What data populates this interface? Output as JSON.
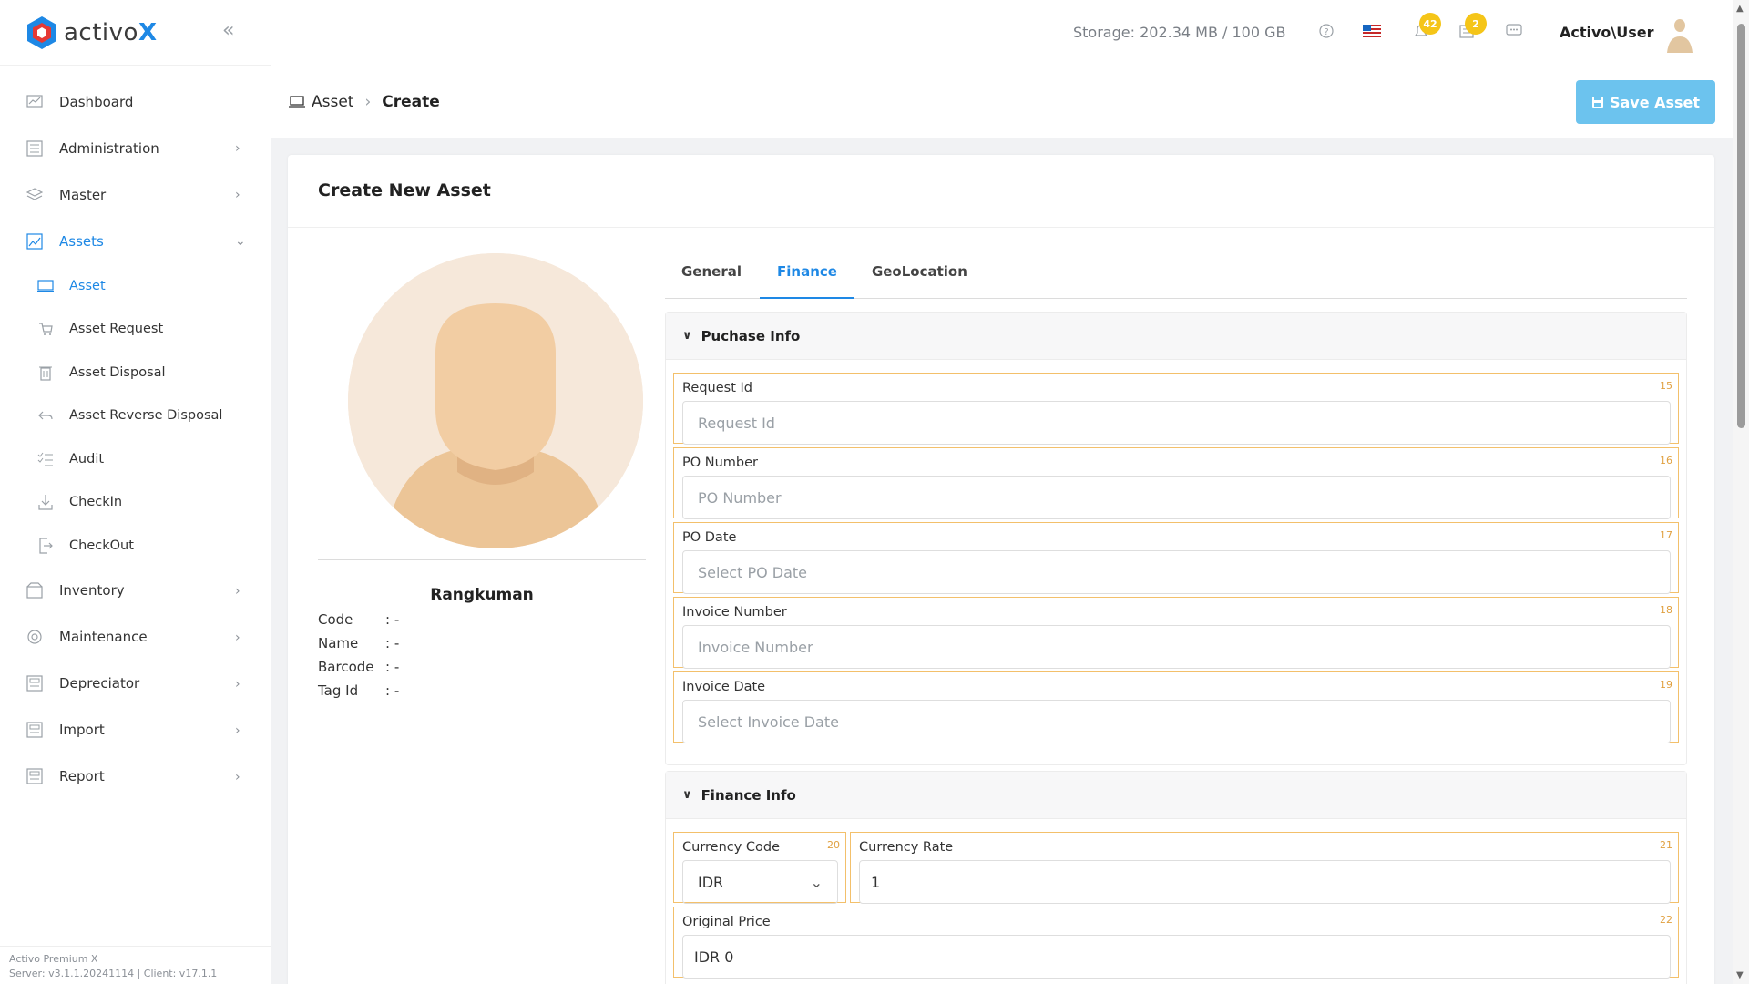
{
  "brand": {
    "name_prefix": "activo",
    "name_suffix": "X",
    "collapse_icon": "double-chevron-left"
  },
  "sidebar": {
    "items": [
      {
        "label": "Dashboard",
        "icon": "dashboard-icon",
        "has_children": false
      },
      {
        "label": "Administration",
        "icon": "administration-icon",
        "has_children": true
      },
      {
        "label": "Master",
        "icon": "master-icon",
        "has_children": true
      },
      {
        "label": "Assets",
        "icon": "assets-icon",
        "has_children": true,
        "expanded": true,
        "active": true
      }
    ],
    "sub_items": [
      {
        "label": "Asset",
        "icon": "asset-icon",
        "active": true
      },
      {
        "label": "Asset Request",
        "icon": "cart-icon"
      },
      {
        "label": "Asset Disposal",
        "icon": "trash-icon"
      },
      {
        "label": "Asset Reverse Disposal",
        "icon": "undo-icon"
      },
      {
        "label": "Audit",
        "icon": "checklist-icon"
      },
      {
        "label": "CheckIn",
        "icon": "download-icon"
      },
      {
        "label": "CheckOut",
        "icon": "logout-icon"
      }
    ],
    "items_after": [
      {
        "label": "Inventory",
        "icon": "inventory-icon"
      },
      {
        "label": "Maintenance",
        "icon": "maintenance-icon"
      },
      {
        "label": "Depreciator",
        "icon": "depreciator-icon"
      },
      {
        "label": "Import",
        "icon": "import-icon"
      },
      {
        "label": "Report",
        "icon": "report-icon"
      }
    ],
    "footer": {
      "product": "Activo Premium X",
      "version": "Server: v3.1.1.20241114 | Client: v17.1.1"
    }
  },
  "topbar": {
    "storage": "Storage: 202.34 MB / 100 GB",
    "notifications_count": "42",
    "tasks_count": "2",
    "user_name": "Activo\\User"
  },
  "breadcrumb": {
    "root": "Asset",
    "current": "Create"
  },
  "actions": {
    "save_label": "Save Asset",
    "accent": "#6cc3ee"
  },
  "card": {
    "title": "Create New Asset"
  },
  "asset_summary": {
    "name": "Rangkuman",
    "rows": [
      {
        "key": "Code",
        "value": ": -"
      },
      {
        "key": "Name",
        "value": ": -"
      },
      {
        "key": "Barcode",
        "value": ": -"
      },
      {
        "key": "Tag Id",
        "value": ": -"
      }
    ]
  },
  "tabs": [
    {
      "label": "General",
      "active": false
    },
    {
      "label": "Finance",
      "active": true
    },
    {
      "label": "GeoLocation",
      "active": false
    }
  ],
  "purchase_info": {
    "title": "Puchase Info",
    "fields": [
      {
        "label": "Request Id",
        "num": "15",
        "placeholder": "Request Id",
        "value": ""
      },
      {
        "label": "PO Number",
        "num": "16",
        "placeholder": "PO Number",
        "value": ""
      },
      {
        "label": "PO Date",
        "num": "17",
        "placeholder": "Select PO Date",
        "value": ""
      },
      {
        "label": "Invoice Number",
        "num": "18",
        "placeholder": "Invoice Number",
        "value": ""
      },
      {
        "label": "Invoice Date",
        "num": "19",
        "placeholder": "Select Invoice Date",
        "value": ""
      }
    ]
  },
  "finance_info": {
    "title": "Finance Info",
    "currency_code": {
      "label": "Currency Code",
      "num": "20",
      "value": "IDR"
    },
    "currency_rate": {
      "label": "Currency Rate",
      "num": "21",
      "value": "1"
    },
    "original_price": {
      "label": "Original Price",
      "num": "22",
      "value": "IDR 0"
    }
  }
}
